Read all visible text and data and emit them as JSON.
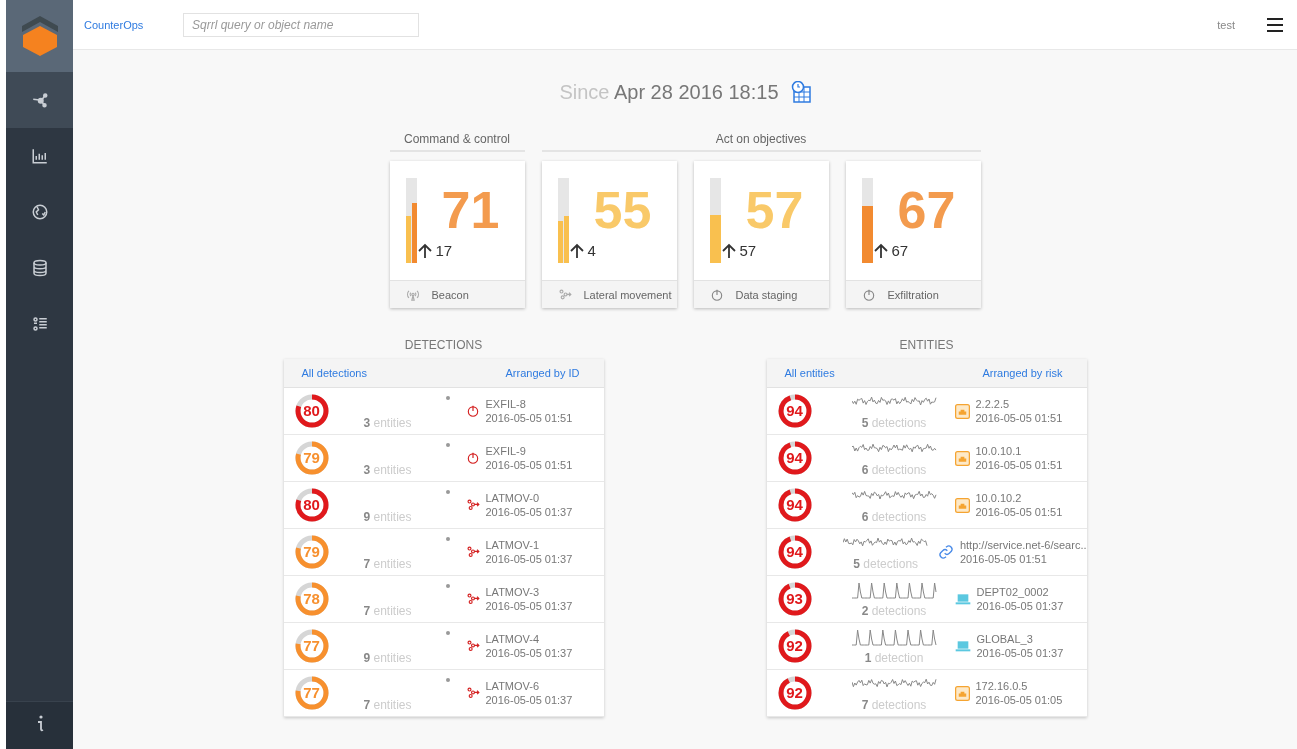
{
  "app_name": "CounterOps",
  "search": {
    "placeholder": "Sqrrl query or object name"
  },
  "user": "test",
  "sidebar": {
    "items": [
      {
        "kind": "graph",
        "selected": true
      },
      {
        "kind": "chart",
        "selected": false
      },
      {
        "kind": "globe",
        "selected": false
      },
      {
        "kind": "database",
        "selected": false
      },
      {
        "kind": "list",
        "selected": false
      }
    ]
  },
  "since": {
    "label": "Since",
    "date": "Apr 28 2016 18:15"
  },
  "groups": [
    {
      "title": "Command & control"
    },
    {
      "title": "Act on objectives"
    }
  ],
  "cards": [
    {
      "value": "71",
      "change": "17",
      "label": "Beacon",
      "kind": "beacon",
      "color": "#f28a30",
      "bars": [
        {
          "level": 0.55,
          "color": "#f9c04f"
        },
        {
          "level": 0.71,
          "color": "#f28a30"
        }
      ]
    },
    {
      "value": "55",
      "change": "4",
      "label": "Lateral movement",
      "kind": "lateral",
      "color": "#f9c04f",
      "bars": [
        {
          "level": 0.5,
          "color": "#f9c04f"
        },
        {
          "level": 0.55,
          "color": "#f9c04f"
        }
      ]
    },
    {
      "value": "57",
      "change": "57",
      "label": "Data staging",
      "kind": "power",
      "color": "#f9c04f",
      "bars": [
        {
          "level": 0.57,
          "color": "#f9c04f"
        }
      ]
    },
    {
      "value": "67",
      "change": "67",
      "label": "Exfiltration",
      "kind": "power",
      "color": "#f28a30",
      "bars": [
        {
          "level": 0.67,
          "color": "#f28a30"
        }
      ]
    }
  ],
  "detections": {
    "title": "DETECTIONS",
    "link": "All detections",
    "sort": "Arranged by ID",
    "rows": [
      {
        "score": "80",
        "level": 0.8,
        "color": "#e0191c",
        "count": "**3** entities",
        "kind": "exfil",
        "id": "EXFIL-8",
        "time": "2016-05-05 01:51"
      },
      {
        "score": "79",
        "level": 0.79,
        "color": "#f7902e",
        "count": "**3** entities",
        "kind": "exfil",
        "id": "EXFIL-9",
        "time": "2016-05-05 01:51"
      },
      {
        "score": "80",
        "level": 0.8,
        "color": "#e0191c",
        "count": "**9** entities",
        "kind": "latmov",
        "id": "LATMOV-0",
        "time": "2016-05-05 01:37"
      },
      {
        "score": "79",
        "level": 0.79,
        "color": "#f7902e",
        "count": "**7** entities",
        "kind": "latmov",
        "id": "LATMOV-1",
        "time": "2016-05-05 01:37"
      },
      {
        "score": "78",
        "level": 0.78,
        "color": "#f7902e",
        "count": "**7** entities",
        "kind": "latmov",
        "id": "LATMOV-3",
        "time": "2016-05-05 01:37"
      },
      {
        "score": "77",
        "level": 0.77,
        "color": "#f7902e",
        "count": "**9** entities",
        "kind": "latmov",
        "id": "LATMOV-4",
        "time": "2016-05-05 01:37"
      },
      {
        "score": "77",
        "level": 0.77,
        "color": "#f7902e",
        "count": "**7** entities",
        "kind": "latmov",
        "id": "LATMOV-6",
        "time": "2016-05-05 01:37"
      }
    ]
  },
  "entities": {
    "title": "ENTITIES",
    "link": "All entities",
    "sort": "Arranged by risk",
    "rows": [
      {
        "score": "94",
        "level": 0.94,
        "color": "#e0191c",
        "count": "**5** detections",
        "kind": "network",
        "name": "2.2.2.5",
        "time": "2016-05-05 01:51"
      },
      {
        "score": "94",
        "level": 0.94,
        "color": "#e0191c",
        "count": "**6** detections",
        "kind": "network",
        "name": "10.0.10.1",
        "time": "2016-05-05 01:51"
      },
      {
        "score": "94",
        "level": 0.94,
        "color": "#e0191c",
        "count": "**6** detections",
        "kind": "network",
        "name": "10.0.10.2",
        "time": "2016-05-05 01:51"
      },
      {
        "score": "94",
        "level": 0.94,
        "color": "#e0191c",
        "count": "**5** detections",
        "kind": "link",
        "name": "http://service.net-6/searc..",
        "time": "2016-05-05 01:51"
      },
      {
        "score": "93",
        "level": 0.93,
        "color": "#e0191c",
        "count": "**2** detections",
        "kind": "host",
        "name": "DEPT02_0002",
        "time": "2016-05-05 01:37"
      },
      {
        "score": "92",
        "level": 0.92,
        "color": "#e0191c",
        "count": "**1** detection",
        "kind": "host",
        "name": "GLOBAL_3",
        "time": "2016-05-05 01:37"
      },
      {
        "score": "92",
        "level": 0.92,
        "color": "#e0191c",
        "count": "**7** detections",
        "kind": "network",
        "name": "172.16.0.5",
        "time": "2016-05-05 01:05"
      }
    ]
  }
}
